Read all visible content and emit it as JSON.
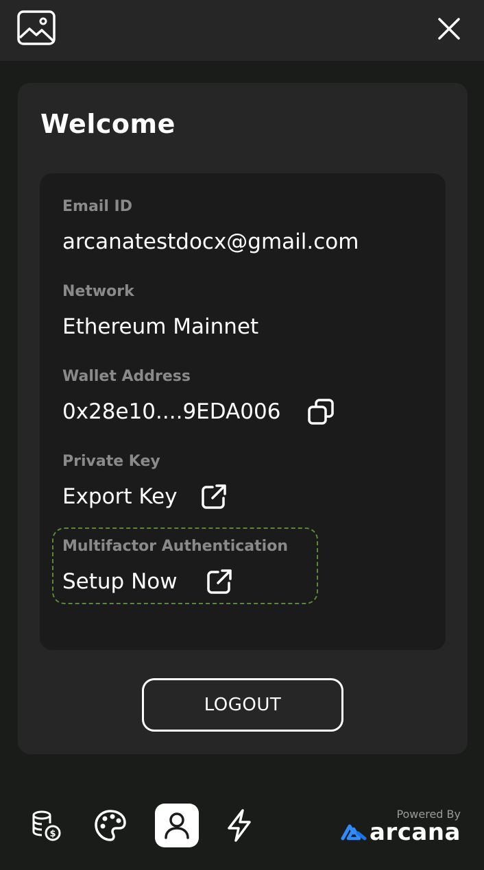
{
  "header": {
    "left_icon": "image-icon",
    "close_icon": "close-icon"
  },
  "profile": {
    "title": "Welcome",
    "fields": {
      "email": {
        "label": "Email ID",
        "value": "arcanatestdocx@gmail.com"
      },
      "network": {
        "label": "Network",
        "value": "Ethereum Mainnet"
      },
      "wallet": {
        "label": "Wallet Address",
        "value": "0x28e10....9EDA006",
        "icon": "copy-icon"
      },
      "private_key": {
        "label": "Private Key",
        "value": "Export Key",
        "icon": "external-link-icon"
      },
      "mfa": {
        "label": "Multifactor Authentication",
        "value": "Setup Now",
        "icon": "external-link-icon"
      }
    },
    "logout_label": "LOGOUT"
  },
  "nav": {
    "items": [
      {
        "name": "tokens",
        "icon": "coins-icon",
        "active": false
      },
      {
        "name": "nfts",
        "icon": "palette-icon",
        "active": false
      },
      {
        "name": "profile",
        "icon": "user-icon",
        "active": true
      },
      {
        "name": "activity",
        "icon": "lightning-icon",
        "active": false
      }
    ],
    "powered_by": "Powered By",
    "brand": "arcana"
  },
  "colors": {
    "background": "#1a1c19",
    "card": "#262626",
    "panel": "#1b1b1b",
    "label": "#8a8a8a",
    "mfa_border": "#5a8a36",
    "brand_accent": "#2f8cff"
  }
}
